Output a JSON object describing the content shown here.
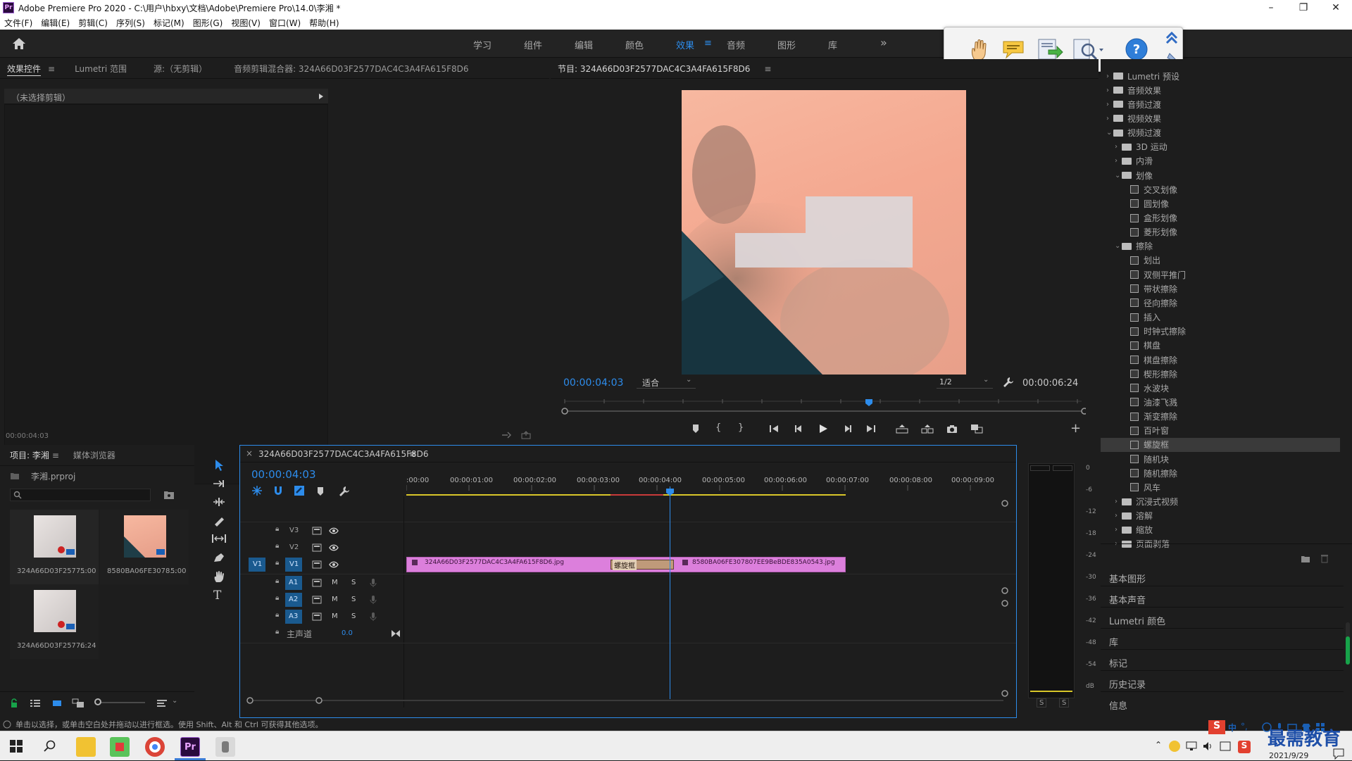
{
  "app": {
    "title": "Adobe Premiere Pro 2020 - C:\\用户\\hbxy\\文档\\Adobe\\Premiere Pro\\14.0\\李湘 *",
    "logo_text": "Pr",
    "win_min": "–",
    "win_max": "❐",
    "win_close": "✕"
  },
  "menu": [
    "文件(F)",
    "编辑(E)",
    "剪辑(C)",
    "序列(S)",
    "标记(M)",
    "图形(G)",
    "视图(V)",
    "窗口(W)",
    "帮助(H)"
  ],
  "workspaces": [
    "学习",
    "组件",
    "编辑",
    "颜色",
    "效果",
    "音频",
    "图形",
    "库"
  ],
  "workspace_more": "»",
  "workspace_active_index": 4,
  "workspace_menu_icon": "≡",
  "effect_controls": {
    "tabs": [
      "效果控件",
      "Lumetri 范围",
      "源:（无剪辑）",
      "音频剪辑混合器: 324A66D03F2577DAC4C3A4FA615F8D6"
    ],
    "tab_menu": "≡",
    "no_clip": "（未选择剪辑）",
    "time": "00:00:04:03"
  },
  "program": {
    "title": "节目: 324A66D03F2577DAC4C3A4FA615F8D6",
    "menu": "≡",
    "timecode": "00:00:04:03",
    "fit": "适合",
    "resolution": "1/2",
    "duration": "00:00:06:24",
    "playhead_fraction": 0.585
  },
  "effects_tree": [
    {
      "label": "Lumetri 预设",
      "level": 0,
      "kind": "folder",
      "open": false
    },
    {
      "label": "音频效果",
      "level": 0,
      "kind": "folder",
      "open": false
    },
    {
      "label": "音频过渡",
      "level": 0,
      "kind": "folder",
      "open": false
    },
    {
      "label": "视频效果",
      "level": 0,
      "kind": "folder",
      "open": false
    },
    {
      "label": "视频过渡",
      "level": 0,
      "kind": "folder",
      "open": true
    },
    {
      "label": "3D 运动",
      "level": 1,
      "kind": "folder",
      "open": false
    },
    {
      "label": "内滑",
      "level": 1,
      "kind": "folder",
      "open": false
    },
    {
      "label": "划像",
      "level": 1,
      "kind": "folder",
      "open": true
    },
    {
      "label": "交叉划像",
      "level": 2,
      "kind": "fx"
    },
    {
      "label": "圆划像",
      "level": 2,
      "kind": "fx"
    },
    {
      "label": "盒形划像",
      "level": 2,
      "kind": "fx"
    },
    {
      "label": "菱形划像",
      "level": 2,
      "kind": "fx"
    },
    {
      "label": "擦除",
      "level": 1,
      "kind": "folder",
      "open": true
    },
    {
      "label": "划出",
      "level": 2,
      "kind": "fx"
    },
    {
      "label": "双侧平推门",
      "level": 2,
      "kind": "fx"
    },
    {
      "label": "带状擦除",
      "level": 2,
      "kind": "fx"
    },
    {
      "label": "径向擦除",
      "level": 2,
      "kind": "fx"
    },
    {
      "label": "插入",
      "level": 2,
      "kind": "fx"
    },
    {
      "label": "时钟式擦除",
      "level": 2,
      "kind": "fx"
    },
    {
      "label": "棋盘",
      "level": 2,
      "kind": "fx"
    },
    {
      "label": "棋盘擦除",
      "level": 2,
      "kind": "fx"
    },
    {
      "label": "楔形擦除",
      "level": 2,
      "kind": "fx"
    },
    {
      "label": "水波块",
      "level": 2,
      "kind": "fx"
    },
    {
      "label": "油漆飞溅",
      "level": 2,
      "kind": "fx"
    },
    {
      "label": "渐变擦除",
      "level": 2,
      "kind": "fx"
    },
    {
      "label": "百叶窗",
      "level": 2,
      "kind": "fx"
    },
    {
      "label": "螺旋框",
      "level": 2,
      "kind": "fx",
      "selected": true
    },
    {
      "label": "随机块",
      "level": 2,
      "kind": "fx"
    },
    {
      "label": "随机擦除",
      "level": 2,
      "kind": "fx"
    },
    {
      "label": "风车",
      "level": 2,
      "kind": "fx"
    },
    {
      "label": "沉浸式视频",
      "level": 1,
      "kind": "folder",
      "open": false
    },
    {
      "label": "溶解",
      "level": 1,
      "kind": "folder",
      "open": false
    },
    {
      "label": "缩放",
      "level": 1,
      "kind": "folder",
      "open": false
    },
    {
      "label": "页面剥落",
      "level": 1,
      "kind": "folder",
      "open": false
    }
  ],
  "side_panels": [
    "基本图形",
    "基本声音",
    "Lumetri 颜色",
    "库",
    "标记",
    "历史记录",
    "信息"
  ],
  "project": {
    "tabs": [
      "项目: 李湘",
      "媒体浏览器"
    ],
    "tab_menu": "≡",
    "file": "李湘.prproj",
    "items": [
      {
        "name": "324A66D03F2577...",
        "duration": "5:00"
      },
      {
        "name": "8580BA06FE3078...",
        "duration": "5:00"
      },
      {
        "name": "324A66D03F2577...",
        "duration": "6:24"
      }
    ]
  },
  "timeline": {
    "close": "×",
    "title": "324A66D03F2577DAC4C3A4FA615F8D6",
    "menu": "≡",
    "timecode": "00:00:04:03",
    "ruler": [
      ":00:00",
      "00:00:01:00",
      "00:00:02:00",
      "00:00:03:00",
      "00:00:04:00",
      "00:00:05:00",
      "00:00:06:00",
      "00:00:07:00",
      "00:00:08:00",
      "00:00:09:00"
    ],
    "video_tracks": [
      "V3",
      "V2",
      "V1"
    ],
    "audio_tracks": [
      "A1",
      "A2",
      "A3"
    ],
    "source_patch": "V1",
    "master": "主声道",
    "master_value": "0.0",
    "mute": "M",
    "solo": "S",
    "clip1": "324A66D03F2577DAC4C3A4FA615F8D6.jpg",
    "transition": "螺旋框",
    "clip2": "8580BA06FE307807EE9BeBDE835A0543.jpg"
  },
  "meters": {
    "scale": [
      "0",
      "-6",
      "-12",
      "-18",
      "-24",
      "-30",
      "-36",
      "-42",
      "-48",
      "-54",
      "dB"
    ],
    "solo_l": "S",
    "solo_r": "S"
  },
  "status_text": "单击以选择，或单击空白处并拖动以进行框选。使用 Shift、Alt 和 Ctrl 可获得其他选项。",
  "taskbar": {
    "pr": "Pr",
    "brand": "最需教育",
    "date": "2021/9/29",
    "tray_ime": "中",
    "tray_extra": "°,"
  }
}
